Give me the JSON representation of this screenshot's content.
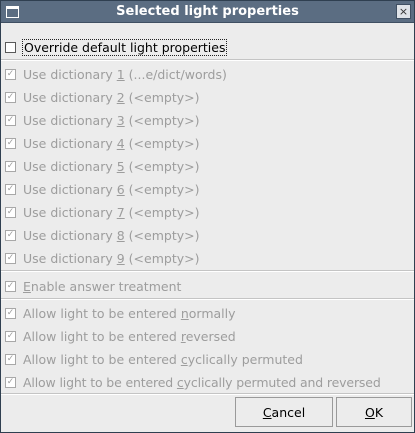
{
  "window": {
    "title": "Selected light properties",
    "close_glyph": "×"
  },
  "override": {
    "label": "Override default light properties",
    "checked": false
  },
  "dictionaries": [
    {
      "pre": "Use dictionary ",
      "key": "1",
      "post": " (...e/dict/words)",
      "checked": true
    },
    {
      "pre": "Use dictionary ",
      "key": "2",
      "post": " (<empty>)",
      "checked": true
    },
    {
      "pre": "Use dictionary ",
      "key": "3",
      "post": " (<empty>)",
      "checked": true
    },
    {
      "pre": "Use dictionary ",
      "key": "4",
      "post": " (<empty>)",
      "checked": true
    },
    {
      "pre": "Use dictionary ",
      "key": "5",
      "post": " (<empty>)",
      "checked": true
    },
    {
      "pre": "Use dictionary ",
      "key": "6",
      "post": " (<empty>)",
      "checked": true
    },
    {
      "pre": "Use dictionary ",
      "key": "7",
      "post": " (<empty>)",
      "checked": true
    },
    {
      "pre": "Use dictionary ",
      "key": "8",
      "post": " (<empty>)",
      "checked": true
    },
    {
      "pre": "Use dictionary ",
      "key": "9",
      "post": " (<empty>)",
      "checked": true
    }
  ],
  "answer_treatment": {
    "pre": "",
    "key": "E",
    "post": "nable answer treatment",
    "checked": true
  },
  "entry_options": [
    {
      "pre": "Allow light to be entered ",
      "key": "n",
      "post": "ormally",
      "checked": true
    },
    {
      "pre": "Allow light to be entered ",
      "key": "r",
      "post": "eversed",
      "checked": true
    },
    {
      "pre": "Allow light to be entered ",
      "key": "c",
      "post": "yclically permuted",
      "checked": true
    },
    {
      "pre": "Allow light to be entered ",
      "key": "c",
      "post": "yclically permuted and reversed",
      "checked": true
    }
  ],
  "buttons": {
    "cancel": {
      "key": "C",
      "rest": "ancel"
    },
    "ok": {
      "key": "O",
      "rest": "K"
    }
  }
}
